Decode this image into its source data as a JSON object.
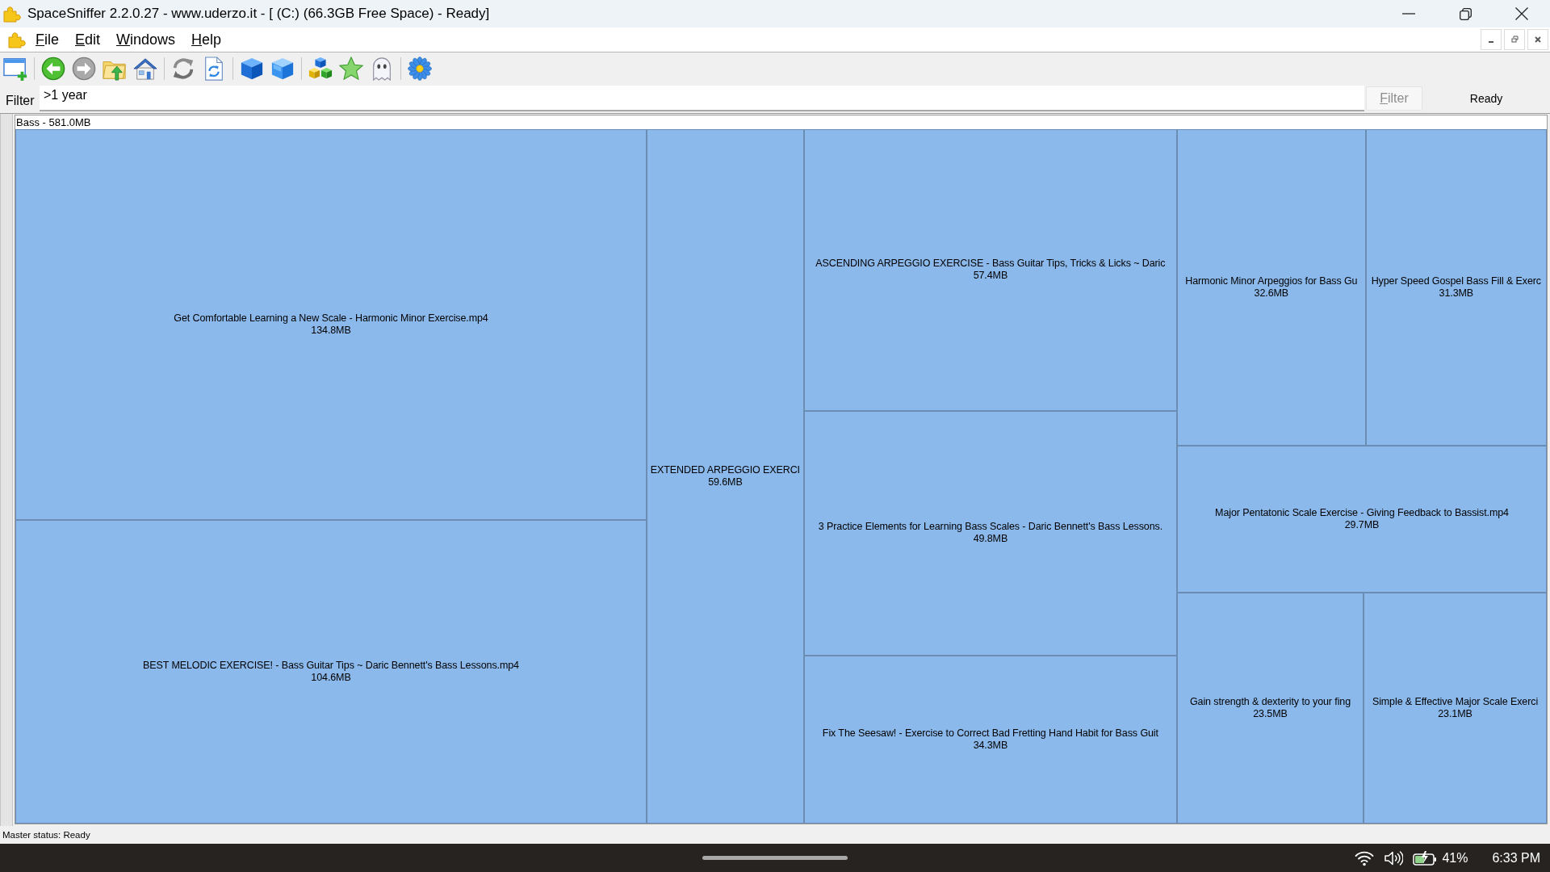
{
  "window": {
    "title": "SpaceSniffer 2.2.0.27 - www.uderzo.it - [ (C:) (66.3GB Free Space) - Ready]"
  },
  "menu": [
    "File",
    "Edit",
    "Windows",
    "Help"
  ],
  "filter": {
    "label": "Filter",
    "value": ">1 year",
    "button": {
      "label": "Filter",
      "disabled": true
    },
    "status": "Ready"
  },
  "treemap": {
    "header": "Bass - 581.0MB",
    "columns": [
      {
        "rows": [
          {
            "tiles": [
              {
                "name": "Get Comfortable Learning a New Scale - Harmonic Minor Exercise.mp4",
                "size": "134.8MB"
              }
            ]
          },
          {
            "tiles": [
              {
                "name": "BEST MELODIC EXERCISE! - Bass Guitar Tips ~ Daric Bennett's Bass Lessons.mp4",
                "size": "104.6MB"
              }
            ]
          }
        ]
      },
      {
        "rows": [
          {
            "tiles": [
              {
                "name": "EXTENDED ARPEGGIO EXERCI",
                "size": "59.6MB"
              }
            ]
          }
        ]
      },
      {
        "rows": [
          {
            "tiles": [
              {
                "name": "ASCENDING ARPEGGIO EXERCISE - Bass Guitar Tips, Tricks & Licks ~ Daric",
                "size": "57.4MB"
              }
            ]
          },
          {
            "tiles": [
              {
                "name": "3 Practice Elements for Learning Bass Scales - Daric Bennett's Bass Lessons.",
                "size": "49.8MB"
              }
            ]
          },
          {
            "tiles": [
              {
                "name": "Fix The Seesaw! - Exercise to Correct Bad Fretting Hand Habit for Bass Guit",
                "size": "34.3MB"
              }
            ]
          }
        ]
      },
      {
        "rows": [
          {
            "tiles": [
              {
                "name": "Harmonic Minor Arpeggios for Bass Gu",
                "size": "32.6MB"
              },
              {
                "name": "Hyper Speed Gospel Bass Fill & Exerc",
                "size": "31.3MB"
              }
            ]
          },
          {
            "tiles": [
              {
                "name": "Major Pentatonic Scale Exercise - Giving Feedback to Bassist.mp4",
                "size": "29.7MB"
              }
            ]
          },
          {
            "tiles": [
              {
                "name": "Gain strength & dexterity to your fing",
                "size": "23.5MB"
              },
              {
                "name": "Simple & Effective Major Scale Exerci",
                "size": "23.1MB"
              }
            ]
          }
        ]
      }
    ]
  },
  "status_bar": "Master status: Ready",
  "taskbar": {
    "battery": "41%",
    "time": "6:33 PM"
  }
}
